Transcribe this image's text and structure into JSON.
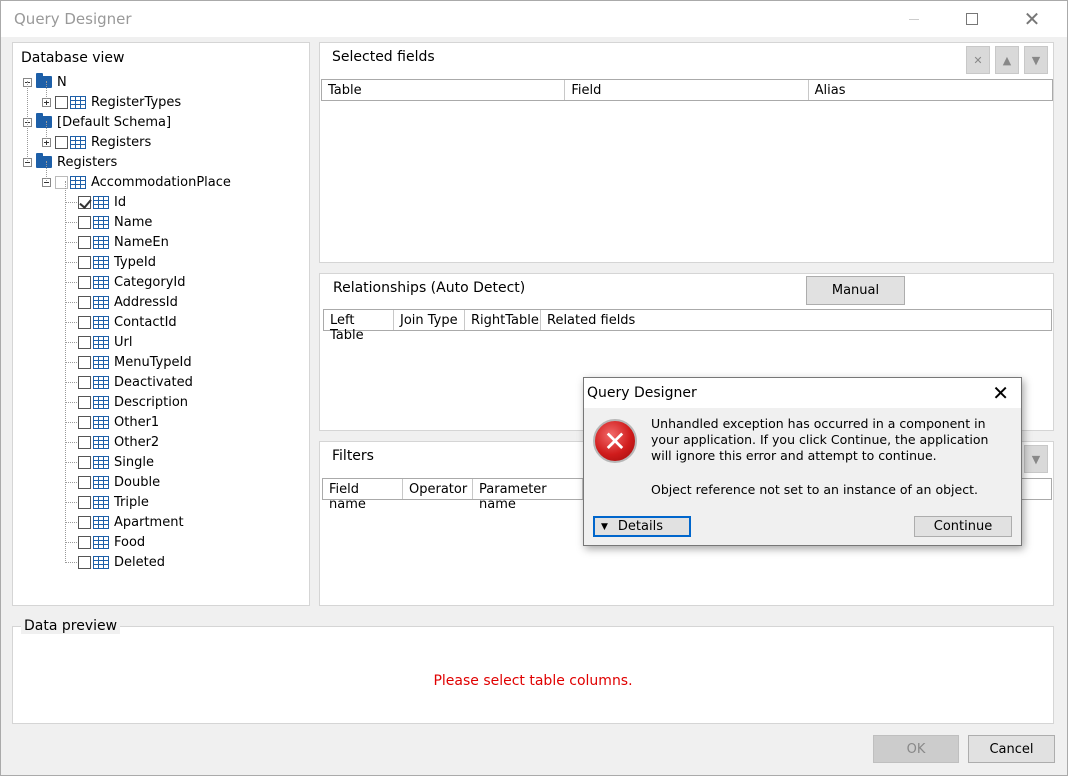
{
  "window": {
    "title": "Query Designer"
  },
  "database_view": {
    "title": "Database view",
    "nodes": [
      {
        "label": "N"
      },
      {
        "label": "RegisterTypes"
      },
      {
        "label": "[Default Schema]"
      },
      {
        "label": "Registers"
      },
      {
        "label": "Registers"
      },
      {
        "label": "AccommodationPlace"
      }
    ],
    "fields": [
      "Id",
      "Name",
      "NameEn",
      "TypeId",
      "CategoryId",
      "AddressId",
      "ContactId",
      "Url",
      "MenuTypeId",
      "Deactivated",
      "Description",
      "Other1",
      "Other2",
      "Single",
      "Double",
      "Triple",
      "Apartment",
      "Food",
      "Deleted"
    ]
  },
  "selected_fields": {
    "title": "Selected fields",
    "columns": [
      "Table",
      "Field",
      "Alias"
    ],
    "toolbar": {
      "delete_icon": "x-icon",
      "up_icon": "arrow-up-icon",
      "down_icon": "arrow-down-icon"
    }
  },
  "relationships": {
    "title": "Relationships (Auto Detect)",
    "manual_label": "Manual",
    "columns": [
      "Left Table",
      "Join Type",
      "RightTable",
      "Related fields"
    ]
  },
  "filters": {
    "title": "Filters",
    "columns": [
      "Field name",
      "Operator",
      "Parameter name"
    ]
  },
  "data_preview": {
    "title": "Data preview",
    "message": "Please select table columns.",
    "message_color": "#e00000"
  },
  "footer": {
    "ok_label": "OK",
    "cancel_label": "Cancel"
  },
  "dialog": {
    "title": "Query Designer",
    "message": "Unhandled exception has occurred in a component in your application. If you click Continue, the application will ignore this error and attempt to continue.",
    "detail": "Object reference not set to an instance of an object.",
    "details_label": "Details",
    "continue_label": "Continue",
    "icon": "error-icon"
  }
}
